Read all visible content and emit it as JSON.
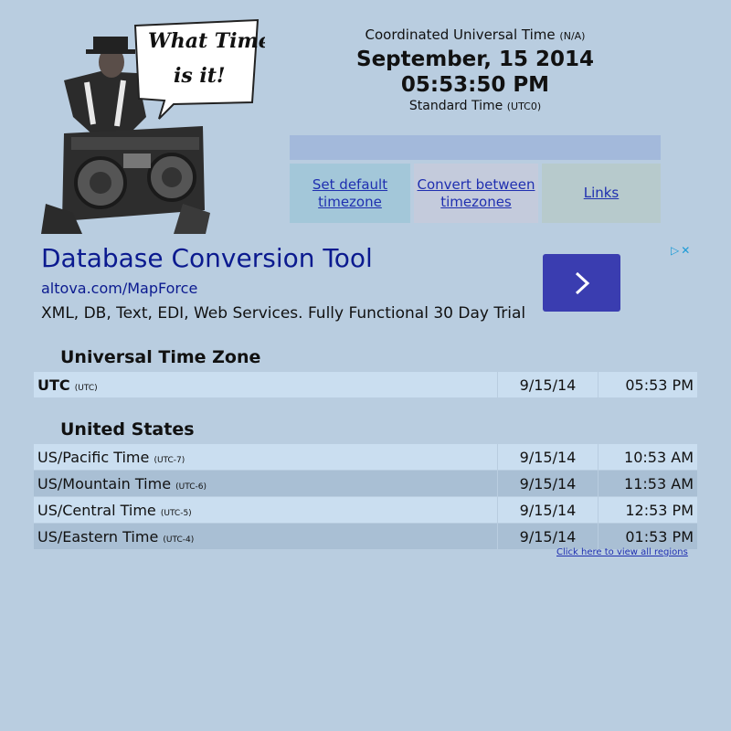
{
  "logo": {
    "speech_line1": "What Time",
    "speech_line2": "is it!"
  },
  "clock": {
    "zone_name": "Coordinated Universal Time",
    "zone_abbr": "(N/A)",
    "date": "September, 15 2014",
    "time": "05:53:50 PM",
    "std_label": "Standard Time",
    "std_abbr": "(UTC0)"
  },
  "nav": {
    "set_default": "Set default timezone",
    "convert": "Convert between timezones",
    "links": "Links"
  },
  "ad": {
    "headline": "Database Conversion Tool",
    "url": "altova.com/MapForce",
    "description": "XML, DB, Text, EDI, Web Services. Fully Functional 30 Day Trial",
    "button_icon": "chevron-right-icon",
    "adchoices_icon": "▷",
    "close_icon": "✕"
  },
  "universal": {
    "title": "Universal Time Zone",
    "rows": [
      {
        "name": "UTC",
        "abbr": "(UTC)",
        "date": "9/15/14",
        "time": "05:53 PM"
      }
    ]
  },
  "us": {
    "title": "United States",
    "rows": [
      {
        "name": "US/Pacific Time",
        "abbr": "(UTC-7)",
        "date": "9/15/14",
        "time": "10:53 AM"
      },
      {
        "name": "US/Mountain Time",
        "abbr": "(UTC-6)",
        "date": "9/15/14",
        "time": "11:53 AM"
      },
      {
        "name": "US/Central Time",
        "abbr": "(UTC-5)",
        "date": "9/15/14",
        "time": "12:53 PM"
      },
      {
        "name": "US/Eastern Time",
        "abbr": "(UTC-4)",
        "date": "9/15/14",
        "time": "01:53 PM"
      }
    ]
  },
  "all_regions_link": "Click here to view all regions",
  "colors": {
    "background": "#b9cde0",
    "link": "#1f2fb0",
    "ad_headline": "#0b1a8f",
    "ad_button": "#3a3db0"
  }
}
